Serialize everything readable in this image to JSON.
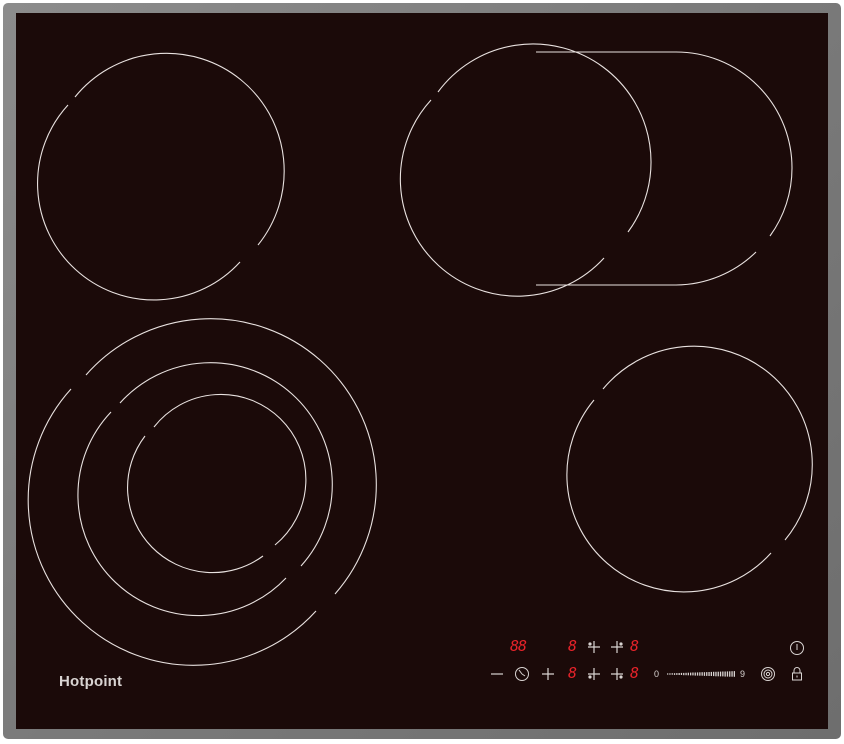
{
  "brand": {
    "name": "Hotpoint"
  },
  "display": {
    "timer_digits": "88",
    "zone_digit": "8"
  },
  "power_slider": {
    "min_label": "0",
    "max_label": "9"
  },
  "icons": {
    "power": "power-icon",
    "lock": "lock-icon",
    "clock": "clock-icon",
    "dual_zone": "dual-zone-icon"
  },
  "colors": {
    "glass": "#1b0a09",
    "frame": "#7a7a7a",
    "zone_lines": "#e9e2e0",
    "display": "#e8232a",
    "controls": "#d9d4d2"
  }
}
